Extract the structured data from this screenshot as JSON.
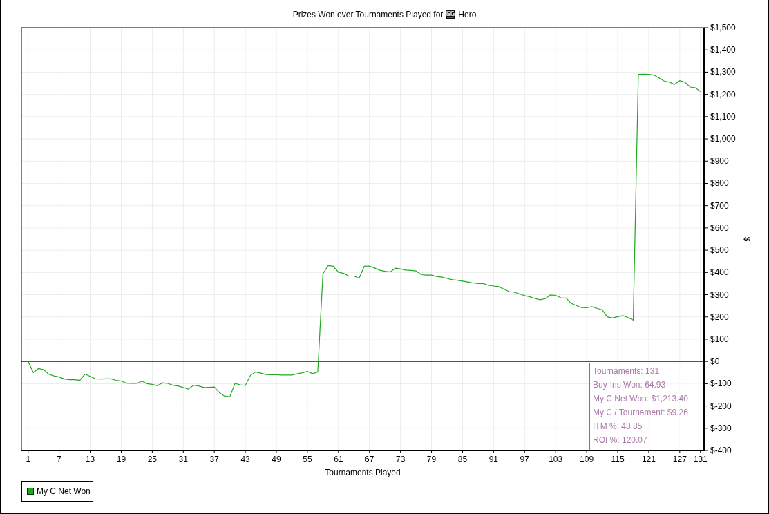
{
  "title": {
    "text": "Prizes Won over Tournaments Played for",
    "player": "Hero"
  },
  "chart": {
    "chart_data": {
      "type": "line",
      "xlabel": "Tournaments Played",
      "ylabel": "$",
      "x": [
        1,
        2,
        3,
        4,
        5,
        6,
        7,
        8,
        9,
        10,
        11,
        12,
        13,
        14,
        15,
        16,
        17,
        18,
        19,
        20,
        21,
        22,
        23,
        24,
        25,
        26,
        27,
        28,
        29,
        30,
        31,
        32,
        33,
        34,
        35,
        36,
        37,
        38,
        39,
        40,
        41,
        42,
        43,
        44,
        45,
        46,
        47,
        48,
        49,
        50,
        51,
        52,
        53,
        54,
        55,
        56,
        57,
        58,
        59,
        60,
        61,
        62,
        63,
        64,
        65,
        66,
        67,
        68,
        69,
        70,
        71,
        72,
        73,
        74,
        75,
        76,
        77,
        78,
        79,
        80,
        81,
        82,
        83,
        84,
        85,
        86,
        87,
        88,
        89,
        90,
        91,
        92,
        93,
        94,
        95,
        96,
        97,
        98,
        99,
        100,
        101,
        102,
        103,
        104,
        105,
        106,
        107,
        108,
        109,
        110,
        111,
        112,
        113,
        114,
        115,
        116,
        117,
        118,
        119,
        120,
        121,
        122,
        123,
        124,
        125,
        126,
        127,
        128,
        129,
        130,
        131
      ],
      "series": [
        {
          "name": "My C Net Won",
          "color": "#1fa81f",
          "values": [
            0,
            -50,
            -32,
            -37,
            -58,
            -65,
            -70,
            -79,
            -82,
            -82,
            -85,
            -57,
            -67,
            -78,
            -79,
            -78,
            -78,
            -85,
            -88,
            -98,
            -99,
            -99,
            -89,
            -100,
            -103,
            -109,
            -96,
            -99,
            -107,
            -110,
            -117,
            -124,
            -107,
            -110,
            -117,
            -116,
            -115,
            -141,
            -156,
            -159,
            -99,
            -105,
            -108,
            -62,
            -47,
            -53,
            -59,
            -60,
            -60,
            -61,
            -61,
            -61,
            -56,
            -51,
            -45,
            -55,
            -48,
            394,
            431,
            428,
            401,
            396,
            384,
            384,
            374,
            428,
            429,
            420,
            410,
            405,
            402,
            419,
            416,
            411,
            409,
            407,
            390,
            388,
            388,
            382,
            379,
            373,
            367,
            365,
            361,
            357,
            353,
            350,
            350,
            342,
            339,
            336,
            325,
            314,
            311,
            304,
            296,
            290,
            283,
            277,
            282,
            299,
            297,
            286,
            285,
            261,
            251,
            242,
            241,
            246,
            239,
            232,
            200,
            195,
            201,
            206,
            197,
            186,
            1290,
            1291,
            1290,
            1287,
            1274,
            1260,
            1255,
            1245,
            1262,
            1255,
            1233,
            1230,
            1213
          ]
        }
      ],
      "grid": true,
      "xlim": [
        -0.3,
        131.7
      ],
      "ylim": [
        -400,
        1500
      ],
      "xticks": [
        1,
        7,
        13,
        19,
        25,
        31,
        37,
        43,
        49,
        55,
        61,
        67,
        73,
        79,
        85,
        91,
        97,
        103,
        109,
        115,
        121,
        127,
        131
      ],
      "yticks": [
        {
          "value": -400,
          "label": "$-400"
        },
        {
          "value": -300,
          "label": "$-300"
        },
        {
          "value": -200,
          "label": "$-200"
        },
        {
          "value": -100,
          "label": "$-100"
        },
        {
          "value": 0,
          "label": "$0"
        },
        {
          "value": 100,
          "label": "$100"
        },
        {
          "value": 200,
          "label": "$200"
        },
        {
          "value": 300,
          "label": "$300"
        },
        {
          "value": 400,
          "label": "$400"
        },
        {
          "value": 500,
          "label": "$500"
        },
        {
          "value": 600,
          "label": "$600"
        },
        {
          "value": 700,
          "label": "$700"
        },
        {
          "value": 800,
          "label": "$800"
        },
        {
          "value": 900,
          "label": "$900"
        },
        {
          "value": 1000,
          "label": "$1,000"
        },
        {
          "value": 1100,
          "label": "$1,100"
        },
        {
          "value": 1200,
          "label": "$1,200"
        },
        {
          "value": 1300,
          "label": "$1,300"
        },
        {
          "value": 1400,
          "label": "$1,400"
        },
        {
          "value": 1500,
          "label": "$1,500"
        }
      ]
    },
    "stats": [
      "Tournaments: 131",
      "Buy-Ins Won: 64.93",
      "My C Net Won: $1,213.40",
      "My C / Tournament: $9.26",
      "ITM %: 48.85",
      "ROI %: 120.07"
    ]
  }
}
